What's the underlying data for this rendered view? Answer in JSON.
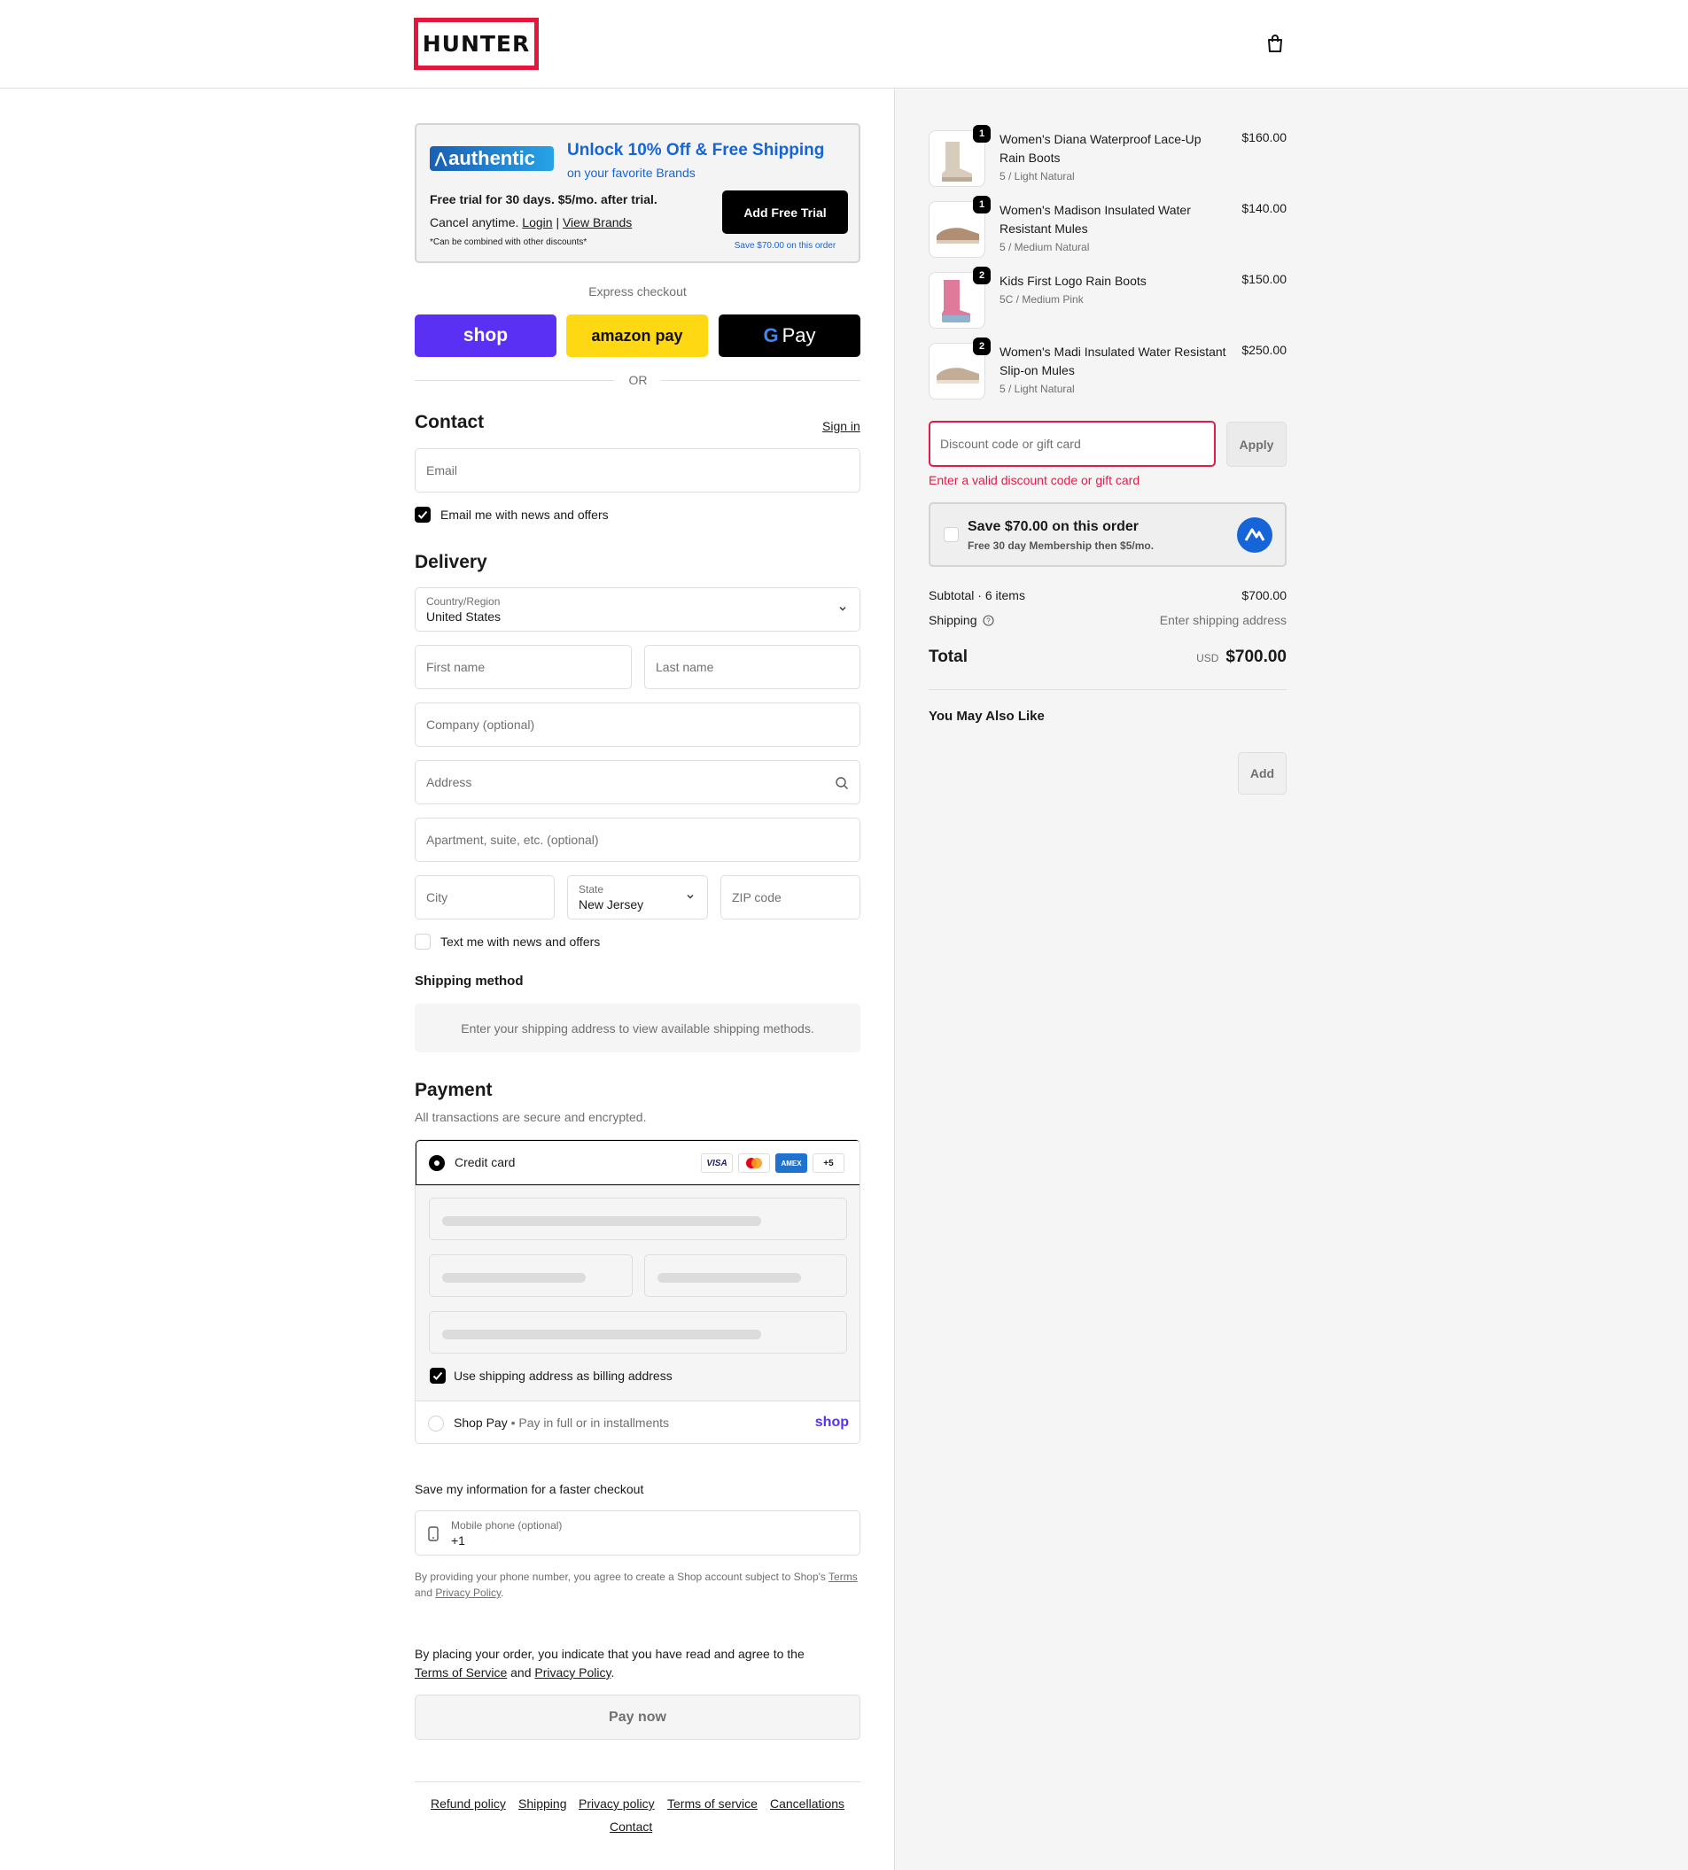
{
  "header": {
    "logo_text": "HUNTER",
    "cart_icon": "shopping-bag-icon"
  },
  "promo": {
    "logo_text": "authentic",
    "title": "Unlock 10% Off & Free Shipping",
    "subtitle": "on your favorite Brands",
    "line1": "Free trial for 30 days. $5/mo. after trial.",
    "line2_prefix": "Cancel anytime.",
    "login_label": "Login",
    "separator": "|",
    "view_brands_label": "View Brands",
    "fine_print": "*Can be combined with other discounts*",
    "button_label": "Add Free Trial",
    "save_note": "Save $70.00 on this order"
  },
  "express": {
    "label": "Express checkout",
    "shop_label": "shop",
    "amazon_label": "amazon pay",
    "gpay_label": "Pay",
    "or_label": "OR"
  },
  "contact": {
    "title": "Contact",
    "signin_label": "Sign in",
    "email_placeholder": "Email",
    "news_label": "Email me with news and offers",
    "news_checked": true
  },
  "delivery": {
    "title": "Delivery",
    "country_label": "Country/Region",
    "country_value": "United States",
    "first_name_placeholder": "First name",
    "last_name_placeholder": "Last name",
    "company_placeholder": "Company (optional)",
    "address_placeholder": "Address",
    "apartment_placeholder": "Apartment, suite, etc. (optional)",
    "city_placeholder": "City",
    "state_label": "State",
    "state_value": "New Jersey",
    "zip_placeholder": "ZIP code",
    "text_label": "Text me with news and offers",
    "text_checked": false
  },
  "shipping_method": {
    "title": "Shipping method",
    "notice": "Enter your shipping address to view available shipping methods."
  },
  "payment": {
    "title": "Payment",
    "subtitle": "All transactions are secure and encrypted.",
    "credit_card_label": "Credit card",
    "card_brands": [
      "VISA",
      "mastercard",
      "AMEX",
      "+5"
    ],
    "billing_label": "Use shipping address as billing address",
    "billing_checked": true,
    "shop_pay_label": "Shop Pay",
    "shop_pay_dot": "•",
    "shop_pay_sub": "Pay in full or in installments",
    "shop_pay_logo": "shop"
  },
  "remember": {
    "title": "Save my information for a faster checkout",
    "phone_label": "Mobile phone (optional)",
    "phone_value": "+1",
    "legal_prefix": "By providing your phone number, you agree to create a Shop account subject to Shop's",
    "terms_label": "Terms",
    "and_label": "and",
    "privacy_label": "Privacy Policy",
    "period": "."
  },
  "agreement": {
    "line1": "By placing your order, you indicate that you have read and agree to the",
    "tos_label": "Terms of Service",
    "and_label": "and",
    "privacy_label": "Privacy Policy",
    "period": "."
  },
  "pay_now_label": "Pay now",
  "footer": {
    "links": [
      "Refund policy",
      "Shipping",
      "Privacy policy",
      "Terms of service",
      "Cancellations",
      "Contact"
    ]
  },
  "cart": {
    "items": [
      {
        "qty": "1",
        "name": "Women's Diana Waterproof Lace-Up Rain Boots",
        "variant": "5 / Light Natural",
        "price": "$160.00"
      },
      {
        "qty": "1",
        "name": "Women's Madison Insulated Water Resistant Mules",
        "variant": "5 / Medium Natural",
        "price": "$140.00"
      },
      {
        "qty": "2",
        "name": "Kids First Logo Rain Boots",
        "variant": "5C / Medium Pink",
        "price": "$150.00"
      },
      {
        "qty": "2",
        "name": "Women's Madi Insulated Water Resistant Slip-on Mules",
        "variant": "5 / Light Natural",
        "price": "$250.00"
      }
    ],
    "discount_placeholder": "Discount code or gift card",
    "apply_label": "Apply",
    "discount_error": "Enter a valid discount code or gift card",
    "save_title": "Save $70.00 on this order",
    "save_sub": "Free 30 day Membership then $5/mo.",
    "subtotal_label": "Subtotal · 6 items",
    "subtotal_value": "$700.00",
    "shipping_label": "Shipping",
    "shipping_value": "Enter shipping address",
    "total_label": "Total",
    "currency": "USD",
    "total_value": "$700.00",
    "upsell_title": "You May Also Like",
    "add_label": "Add"
  },
  "colors": {
    "brand_red": "#e3173e",
    "shop_purple": "#5a31f4",
    "amazon_yellow": "#ffd814",
    "link_blue": "#1565d8",
    "error_red": "#dd1d4a"
  }
}
